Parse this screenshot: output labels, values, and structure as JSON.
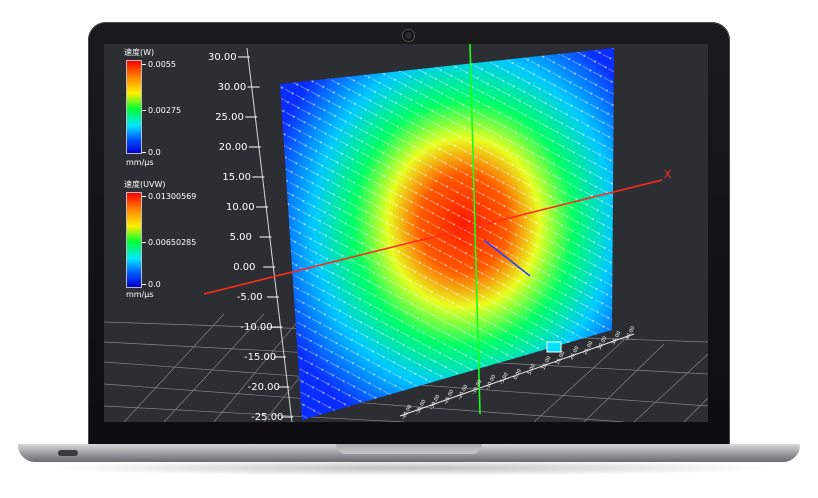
{
  "legend_w": {
    "title": "速度(W)",
    "max": "0.0055",
    "mid": "0.00275",
    "min": "0.0",
    "unit": "mm/μs"
  },
  "legend_uvw": {
    "title": "速度(UVW)",
    "max": "0.01300569",
    "mid": "0.00650285",
    "min": "0.0",
    "unit": "mm/μs"
  },
  "axis": {
    "x_label": "X",
    "y_ticks": [
      "30.00",
      "30.00",
      "25.00",
      "20.00",
      "15.00",
      "10.00",
      "5.00",
      "0.00",
      "-5.00",
      "-10.00",
      "-15.00",
      "-20.00",
      "-25.00"
    ],
    "z_ticks": [
      "-40.00",
      "-35.00",
      "-30.00",
      "-25.00",
      "-20.00",
      "-15.00",
      "-10.00",
      "-5.00",
      "0.00",
      "5.00",
      "10.00",
      "15.00",
      "20.00",
      "25.00",
      "30.00",
      "35.00",
      "40.00"
    ]
  },
  "colors": {
    "red_axis": "#ff2a1f",
    "green_axis": "#19ff19",
    "blue_axis": "#2a3bff",
    "field_low": "#0a2dff",
    "field_high": "#ff1a00"
  }
}
